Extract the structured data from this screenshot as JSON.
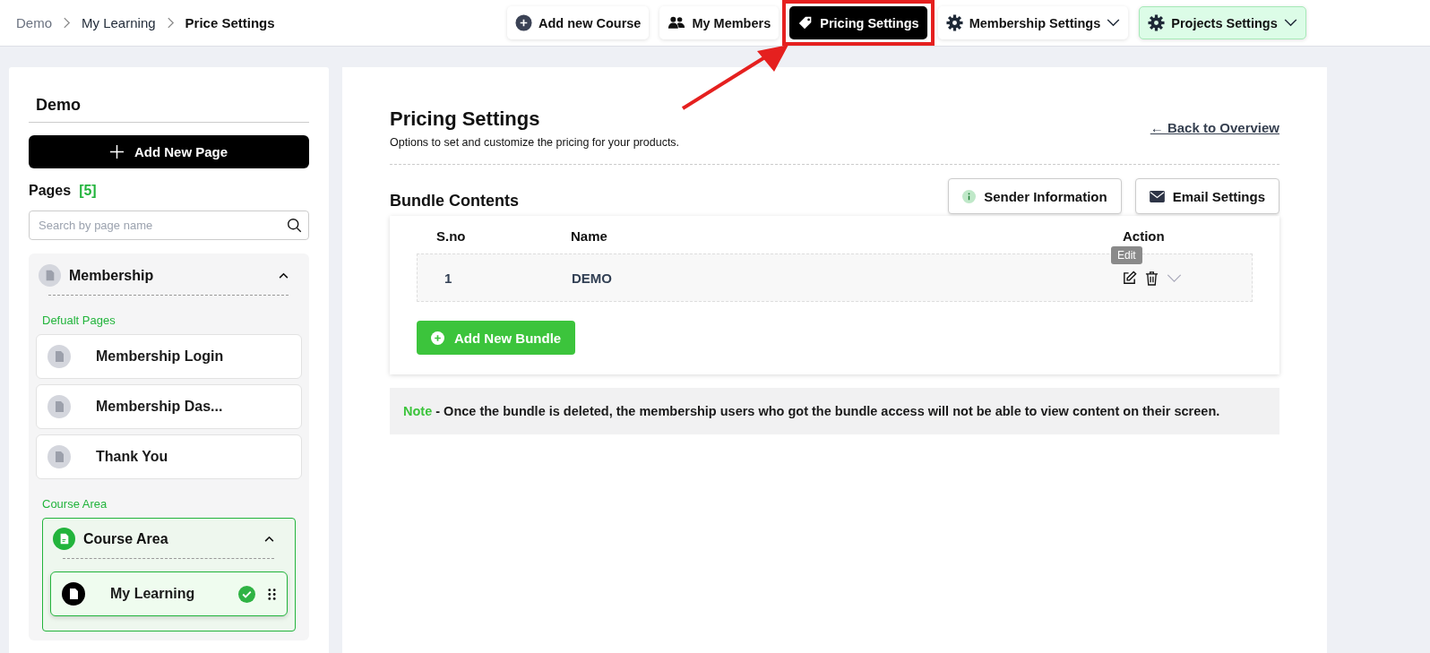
{
  "breadcrumb": [
    {
      "label": "Demo",
      "current": false
    },
    {
      "label": "My Learning",
      "current": false
    },
    {
      "label": "Price Settings",
      "current": true
    }
  ],
  "top_buttons": [
    {
      "label": "Add new Course",
      "kind": "add",
      "selected": false,
      "dropdown": false
    },
    {
      "label": "My Members",
      "kind": "members",
      "selected": false,
      "dropdown": false
    },
    {
      "label": "Pricing Settings",
      "kind": "pricing",
      "selected": true,
      "dropdown": false
    },
    {
      "label": "Membership Settings",
      "kind": "settings",
      "selected": false,
      "dropdown": true
    },
    {
      "label": "Projects Settings",
      "kind": "project",
      "selected": false,
      "dropdown": true
    }
  ],
  "sidebar": {
    "title": "Demo",
    "add_button": "Add New Page",
    "pages_label": "Pages",
    "pages_count": "[5]",
    "search_placeholder": "Search by page name",
    "groups": [
      {
        "kind": "plain",
        "title": "Membership",
        "expanded": true,
        "caption": "Defualt Pages",
        "items": [
          {
            "label": "Membership Login",
            "selected": false,
            "done": false
          },
          {
            "label": "Membership Das...",
            "selected": false,
            "done": false
          },
          {
            "label": "Thank You",
            "selected": false,
            "done": false
          }
        ]
      },
      {
        "kind": "boxed",
        "title": "Course Area",
        "expanded": true,
        "caption": "Course Area",
        "items": [
          {
            "label": "My Learning",
            "selected": true,
            "done": true
          }
        ]
      }
    ]
  },
  "main": {
    "title": "Pricing Settings",
    "subtitle": "Options to set and customize the pricing for your products.",
    "back_link": "← Back to Overview",
    "section_title": "Bundle Contents",
    "buttons": [
      {
        "label": "Sender Information",
        "kind": "info"
      },
      {
        "label": "Email Settings",
        "kind": "mail"
      }
    ],
    "table": {
      "columns": [
        "S.no",
        "Name",
        "Action"
      ],
      "rows": [
        {
          "sno": "1",
          "name": "DEMO",
          "tooltip": "Edit"
        }
      ]
    },
    "add_button": "Add New Bundle",
    "note": {
      "label": "Note",
      "text": " - Once the bundle is deleted, the membership users who got the bundle access will not be able to view content on their screen."
    }
  }
}
